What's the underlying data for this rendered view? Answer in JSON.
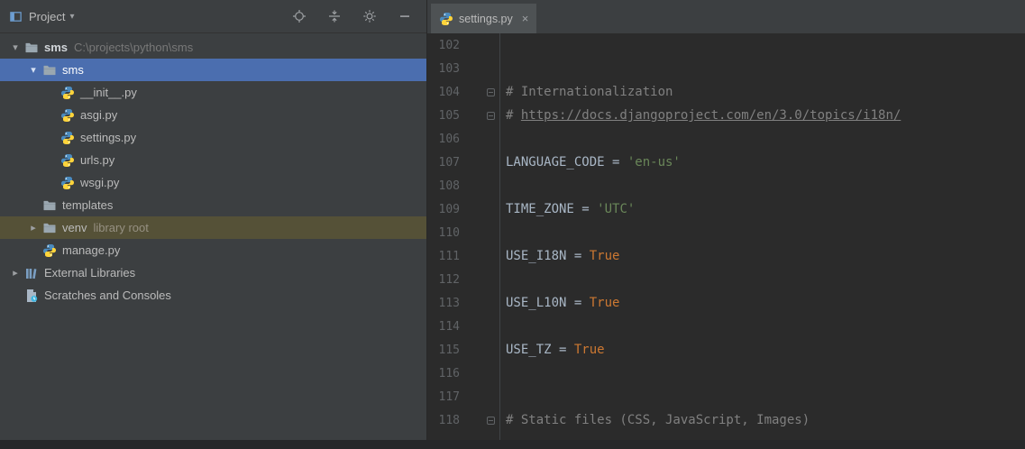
{
  "project_panel": {
    "title": "Project",
    "header_icons": [
      {
        "name": "locate-icon"
      },
      {
        "name": "collapse-all-icon"
      },
      {
        "name": "gear-icon"
      },
      {
        "name": "hide-icon"
      }
    ],
    "tree": [
      {
        "label": "sms",
        "extra": "C:\\projects\\python\\sms",
        "icon": "folder",
        "chevron": "down",
        "indent": 0,
        "bold": true
      },
      {
        "label": "sms",
        "icon": "folder",
        "chevron": "down",
        "indent": 1,
        "state": "selected"
      },
      {
        "label": "__init__.py",
        "icon": "python",
        "indent": 2
      },
      {
        "label": "asgi.py",
        "icon": "python",
        "indent": 2
      },
      {
        "label": "settings.py",
        "icon": "python",
        "indent": 2
      },
      {
        "label": "urls.py",
        "icon": "python",
        "indent": 2
      },
      {
        "label": "wsgi.py",
        "icon": "python",
        "indent": 2
      },
      {
        "label": "templates",
        "icon": "folder",
        "indent": 1
      },
      {
        "label": "venv",
        "extra": "library root",
        "icon": "folder",
        "chevron": "right",
        "indent": 1,
        "state": "library"
      },
      {
        "label": "manage.py",
        "icon": "python",
        "indent": 1
      },
      {
        "label": "External Libraries",
        "icon": "libraries",
        "chevron": "right",
        "indent": 0
      },
      {
        "label": "Scratches and Consoles",
        "icon": "scratches",
        "indent": 0
      }
    ]
  },
  "editor": {
    "tab": {
      "label": "settings.py",
      "close": "×",
      "icon": "python"
    },
    "lines": [
      {
        "n": 102,
        "tokens": []
      },
      {
        "n": 103,
        "tokens": []
      },
      {
        "n": 104,
        "fold": true,
        "tokens": [
          [
            "# Internationalization",
            "c"
          ]
        ]
      },
      {
        "n": 105,
        "fold": true,
        "tokens": [
          [
            "# ",
            "c"
          ],
          [
            "https://docs.djangoproject.com/en/3.0/topics/i18n/",
            "lnk"
          ]
        ]
      },
      {
        "n": 106,
        "tokens": []
      },
      {
        "n": 107,
        "tokens": [
          [
            "LANGUAGE_CODE = ",
            "p"
          ],
          [
            "'en-us'",
            "s"
          ]
        ]
      },
      {
        "n": 108,
        "tokens": []
      },
      {
        "n": 109,
        "tokens": [
          [
            "TIME_ZONE = ",
            "p"
          ],
          [
            "'UTC'",
            "s"
          ]
        ]
      },
      {
        "n": 110,
        "tokens": []
      },
      {
        "n": 111,
        "tokens": [
          [
            "USE_I18N = ",
            "p"
          ],
          [
            "True",
            "k"
          ]
        ]
      },
      {
        "n": 112,
        "tokens": []
      },
      {
        "n": 113,
        "tokens": [
          [
            "USE_L10N = ",
            "p"
          ],
          [
            "True",
            "k"
          ]
        ]
      },
      {
        "n": 114,
        "tokens": []
      },
      {
        "n": 115,
        "tokens": [
          [
            "USE_TZ = ",
            "p"
          ],
          [
            "True",
            "k"
          ]
        ]
      },
      {
        "n": 116,
        "tokens": []
      },
      {
        "n": 117,
        "tokens": []
      },
      {
        "n": 118,
        "fold": true,
        "tokens": [
          [
            "# Static files (CSS, JavaScript, Images)",
            "c"
          ]
        ]
      }
    ]
  },
  "colors": {
    "selection": "#4b6eaf",
    "library_row": "#555137",
    "comment": "#808080",
    "string": "#6a8759",
    "keyword": "#cc7832",
    "plain": "#a9b7c6",
    "line_number": "#606366",
    "panel_bg": "#3c3f41",
    "editor_bg": "#2b2b2b"
  }
}
